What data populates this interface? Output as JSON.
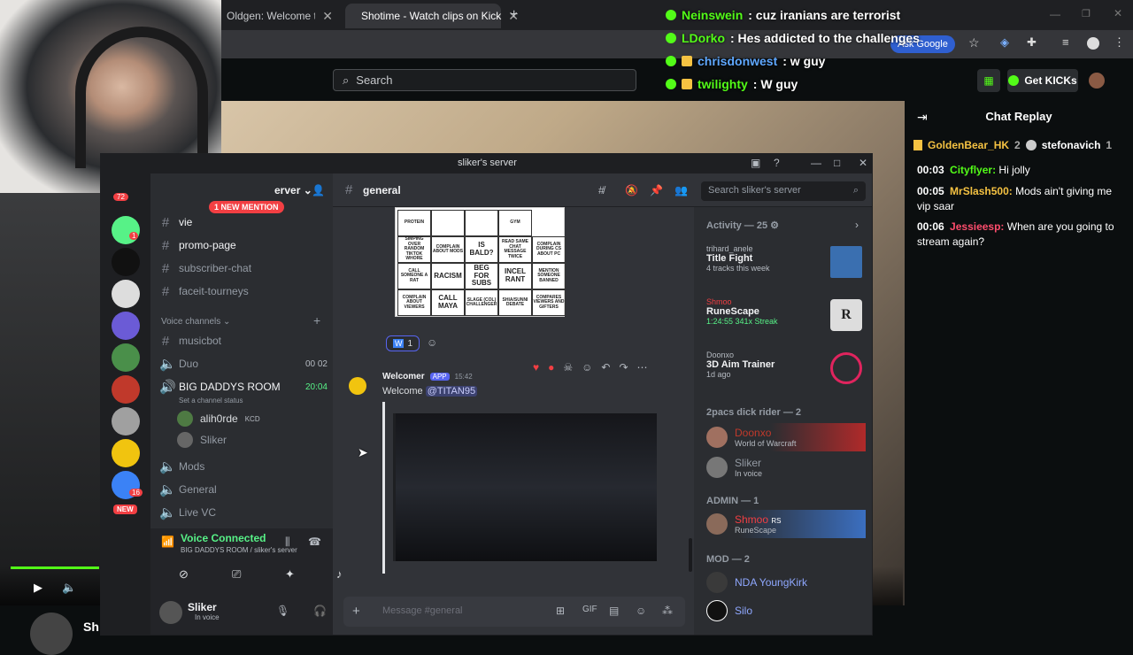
{
  "browser": {
    "tabs": [
      {
        "label": "Oldgen: Welcome to the"
      },
      {
        "label": "Shotime - Watch clips on Kick"
      }
    ],
    "ask_google": "Ask Google"
  },
  "kick": {
    "search_placeholder": "Search",
    "get_kicks": "Get KICKs",
    "chat_replay_title": "Chat Replay",
    "gift_row": {
      "user1": "GoldenBear_HK",
      "count1": "2",
      "user2": "stefonavich",
      "count2": "1"
    },
    "chat_messages": [
      {
        "time": "00:03",
        "user": "Cityflyer:",
        "text": "Hi jolly",
        "color": "#53fc18"
      },
      {
        "time": "00:05",
        "user": "MrSlash500:",
        "text": "Mods ain't giving me vip saar",
        "color": "#f5c242"
      },
      {
        "time": "00:06",
        "user": "Jessieesp:",
        "text": "When are you going to stream again?",
        "color": "#ff4d6d"
      }
    ]
  },
  "overlay_chat": [
    {
      "user": "Neinswein",
      "text": ": cuz iranians are terrorist",
      "color": "#53fc18"
    },
    {
      "user": "LDorko",
      "text": ": Hes addicted to the challenges",
      "color": "#53fc18"
    },
    {
      "user": "chrisdonwest",
      "text": ": w guy",
      "color": "#5fa8ff"
    },
    {
      "user": "twilighty",
      "text": ": W guy",
      "color": "#53fc18"
    }
  ],
  "discord": {
    "window_title": "sliker's server",
    "server_name": "erver",
    "new_mention": "1 NEW MENTION",
    "new_badge": "NEW",
    "channels": [
      {
        "name": "vie",
        "bright": true
      },
      {
        "name": "promo-page",
        "bright": true
      },
      {
        "name": "subscriber-chat",
        "bright": false
      },
      {
        "name": "faceit-tourneys",
        "bright": false
      }
    ],
    "voice_section": "Voice channels",
    "voice_channels": [
      {
        "name": "musicbot",
        "icon": "#"
      },
      {
        "name": "Duo",
        "icon": "speaker",
        "right": "00  02"
      },
      {
        "name": "BIG DADDYS ROOM",
        "icon": "speaker",
        "right": "20:04",
        "bright": true
      }
    ],
    "status_hint": "Set a channel status",
    "voice_users": [
      {
        "name": "alih0rde",
        "tag": "KCD"
      },
      {
        "name": "Sliker",
        "tag": ""
      }
    ],
    "more_channels": [
      "Mods",
      "General",
      "Live VC"
    ],
    "voice_connected": "Voice Connected",
    "voice_location": "BIG DADDYS ROOM / sliker's server",
    "self_user": {
      "name": "Sliker",
      "status": "In voice"
    },
    "current_channel": "general",
    "search_placeholder": "Search sliker's server",
    "reaction_count": "1",
    "message": {
      "author": "Welcomer",
      "app_tag": "APP",
      "time": "15:42",
      "text_prefix": "Welcome ",
      "mention": "@TITAN95"
    },
    "composer_placeholder": "Message #general",
    "guild_badges": {
      "top": "72",
      "mid": "1",
      "low": "16"
    },
    "bingo": [
      [
        "PROTEIN",
        "",
        "",
        "GYM"
      ],
      [
        "SIMPING OVER RANDOM TIKTOK WHORE",
        "COMPLAIN ABOUT MODS",
        "IS BALD?",
        "READ SAME CHAT MESSAGE TWICE",
        "COMPLAIN DURING CS ABOUT PC"
      ],
      [
        "CALL SOMEONE A RAT",
        "RACISM",
        "BEG FOR SUBS",
        "INCEL RANT",
        "MENTION SOMEONE BANNED"
      ],
      [
        "COMPLAIN ABOUT VIEWERS",
        "CALL MAYA",
        "SLAGE (COL) CHALLENGER",
        "SHIA/SUNNI DEBATE",
        "COMPARES VIEWERS AND GIFTERS"
      ]
    ],
    "activity": {
      "title": "Activity — 25",
      "items": [
        {
          "user": "trihard_anele",
          "game": "Title Fight",
          "meta": "4 tracks this week"
        },
        {
          "user": "Shmoo",
          "game": "RuneScape",
          "meta": "1:24:55   341x Streak"
        },
        {
          "user": "Doonxo",
          "game": "3D Aim Trainer",
          "meta": "1d ago"
        }
      ],
      "group1": "2pacs dick rider — 2",
      "group1_members": [
        {
          "name": "Doonxo",
          "sub": "World of Warcraft"
        },
        {
          "name": "Sliker",
          "sub": "In voice"
        }
      ],
      "admin": "ADMIN — 1",
      "admin_members": [
        {
          "name": "Shmoo",
          "tag": "RS",
          "sub": "RuneScape"
        }
      ],
      "mod": "MOD — 2",
      "mod_members": [
        {
          "name": "NDA YoungKirk"
        },
        {
          "name": "Silo"
        }
      ]
    }
  },
  "bottom": {
    "streamer_name_partial": "Sh"
  }
}
